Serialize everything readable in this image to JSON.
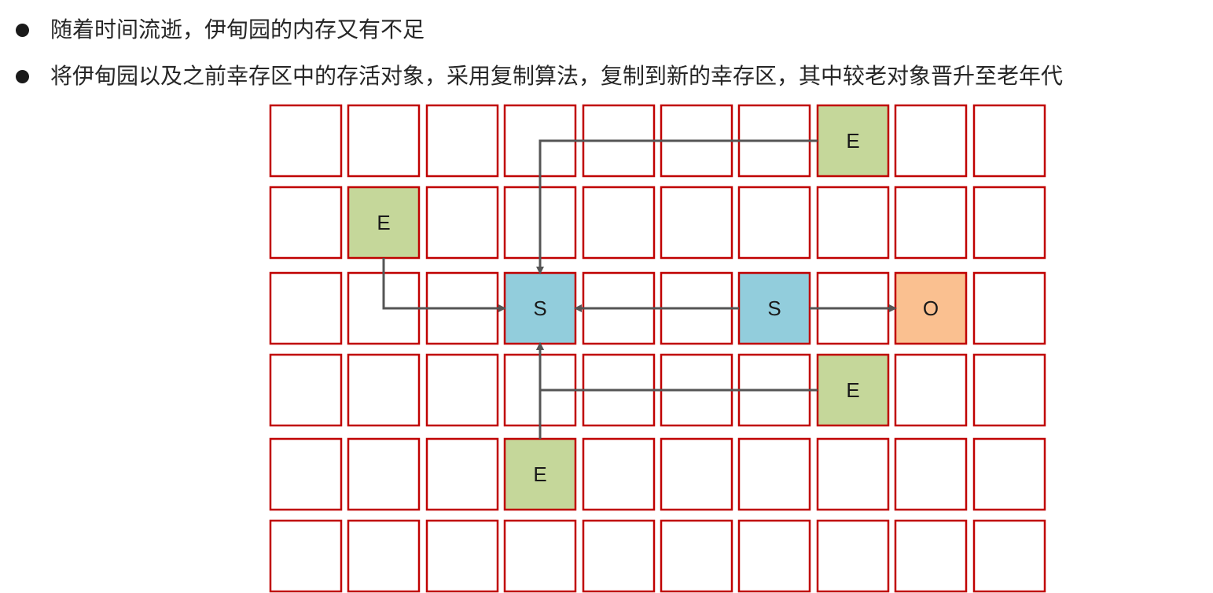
{
  "bullets": [
    "随着时间流逝，伊甸园的内存又有不足",
    "将伊甸园以及之前幸存区中的存活对象，采用复制算法，复制到新的幸存区，其中较老对象晋升至老年代"
  ],
  "grid": {
    "rows": 6,
    "cols": 10,
    "cells": [
      {
        "row": 0,
        "col": 7,
        "label": "E",
        "kind": "eden"
      },
      {
        "row": 1,
        "col": 1,
        "label": "E",
        "kind": "eden"
      },
      {
        "row": 2,
        "col": 3,
        "label": "S",
        "kind": "survivor"
      },
      {
        "row": 2,
        "col": 6,
        "label": "S",
        "kind": "survivor"
      },
      {
        "row": 2,
        "col": 8,
        "label": "O",
        "kind": "old"
      },
      {
        "row": 3,
        "col": 7,
        "label": "E",
        "kind": "eden"
      },
      {
        "row": 4,
        "col": 3,
        "label": "E",
        "kind": "eden"
      }
    ]
  },
  "arrows": [
    {
      "from": [
        0,
        7
      ],
      "to": [
        2,
        3
      ]
    },
    {
      "from": [
        1,
        1
      ],
      "to": [
        2,
        3
      ]
    },
    {
      "from": [
        2,
        6
      ],
      "to": [
        2,
        3
      ]
    },
    {
      "from": [
        2,
        6
      ],
      "to": [
        2,
        8
      ]
    },
    {
      "from": [
        3,
        7
      ],
      "to": [
        2,
        3
      ]
    },
    {
      "from": [
        4,
        3
      ],
      "to": [
        2,
        3
      ]
    }
  ],
  "colors": {
    "cell_border": "#c00000",
    "eden": "#c5d79a",
    "survivor": "#92cddc",
    "old": "#fac090",
    "arrow": "#555555"
  }
}
